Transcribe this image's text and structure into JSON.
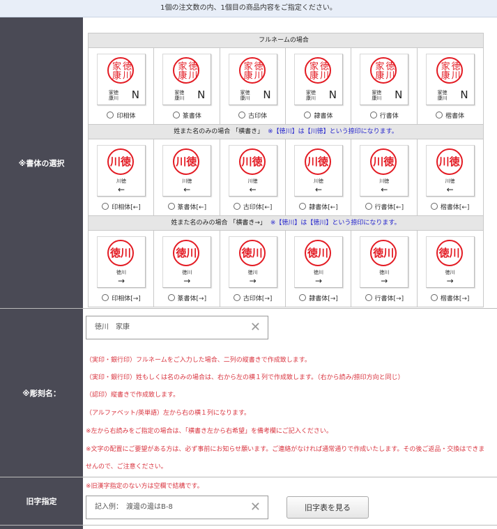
{
  "top_notice": "1個の注文数の内、1個目の商品内容をご指定ください。",
  "font_section": {
    "label": "※書体の選択",
    "groups": [
      {
        "heading": "フルネームの場合",
        "note": "",
        "options": [
          {
            "label": "印相体",
            "seal": "徳川家康",
            "sub": "家徳康川",
            "arrow": "N"
          },
          {
            "label": "篆書体",
            "seal": "徳川家康",
            "sub": "家徳康川",
            "arrow": "N"
          },
          {
            "label": "古印体",
            "seal": "徳川家康",
            "sub": "家徳康川",
            "arrow": "N"
          },
          {
            "label": "隷書体",
            "seal": "徳川家康",
            "sub": "家徳康川",
            "arrow": "N"
          },
          {
            "label": "行書体",
            "seal": "徳川家康",
            "sub": "家徳康川",
            "arrow": "N"
          },
          {
            "label": "楷書体",
            "seal": "徳川家康",
            "sub": "家徳康川",
            "arrow": "N"
          }
        ]
      },
      {
        "heading": "姓また名のみの場合 「横書き」",
        "note": "※【徳川】は【川徳】という捺印になります。",
        "options": [
          {
            "label": "印相体[←]",
            "seal": "川徳",
            "sub": "川徳",
            "arrow": "←"
          },
          {
            "label": "篆書体[←]",
            "seal": "川徳",
            "sub": "川徳",
            "arrow": "←"
          },
          {
            "label": "古印体[←]",
            "seal": "川徳",
            "sub": "川徳",
            "arrow": "←"
          },
          {
            "label": "隷書体[←]",
            "seal": "川徳",
            "sub": "川徳",
            "arrow": "←"
          },
          {
            "label": "行書体[←]",
            "seal": "川徳",
            "sub": "川徳",
            "arrow": "←"
          },
          {
            "label": "楷書体[←]",
            "seal": "川徳",
            "sub": "川徳",
            "arrow": "←"
          }
        ]
      },
      {
        "heading": "姓また名のみの場合 「横書き→」",
        "note": "※【徳川】は【徳川】という捺印になります。",
        "options": [
          {
            "label": "印相体[→]",
            "seal": "徳川",
            "sub": "徳川",
            "arrow": "→"
          },
          {
            "label": "篆書体[→]",
            "seal": "徳川",
            "sub": "徳川",
            "arrow": "→"
          },
          {
            "label": "古印体[→]",
            "seal": "徳川",
            "sub": "徳川",
            "arrow": "→"
          },
          {
            "label": "隷書体[→]",
            "seal": "徳川",
            "sub": "徳川",
            "arrow": "→"
          },
          {
            "label": "行書体[→]",
            "seal": "徳川",
            "sub": "徳川",
            "arrow": "→"
          },
          {
            "label": "楷書体[→]",
            "seal": "徳川",
            "sub": "徳川",
            "arrow": "→"
          }
        ]
      }
    ]
  },
  "engrave_section": {
    "label": "※彫刻名：",
    "input_value": "徳川　家康",
    "notes": [
      "（実印・銀行印）フルネームをご入力した場合、二列の縦書きで作成致します。",
      "（実印・銀行印）姓もしくは名のみの場合は、右から左の横１列で作成致します。（右から読み/捺印方向と同じ）",
      "（認印）縦書きで作成致します。",
      "（アルファベット/英単語）左から右の横１列になります。",
      "※左から右読みをご指定の場合は、「横書き左から右希望」を備考欄にご記入ください。",
      "※文字の配置にご要望がある方は、必ず事前にお知らせ願います。ご連絡がなければ通常通りで作成いたします。その後ご返品・交換はできま",
      "せんので、ご注意ください。"
    ]
  },
  "old_kanji_section": {
    "label": "旧字指定",
    "note": "※旧漢字指定のない方は空欄で結構です。",
    "input_placeholder": "記入例：　渡邊の邊はB-8",
    "button_label": "旧字表を見る"
  },
  "colors": {
    "accent_red": "#e31b23",
    "note_blue": "#2222cc",
    "note_red": "#d9343f",
    "label_bg": "#4a4a55"
  }
}
